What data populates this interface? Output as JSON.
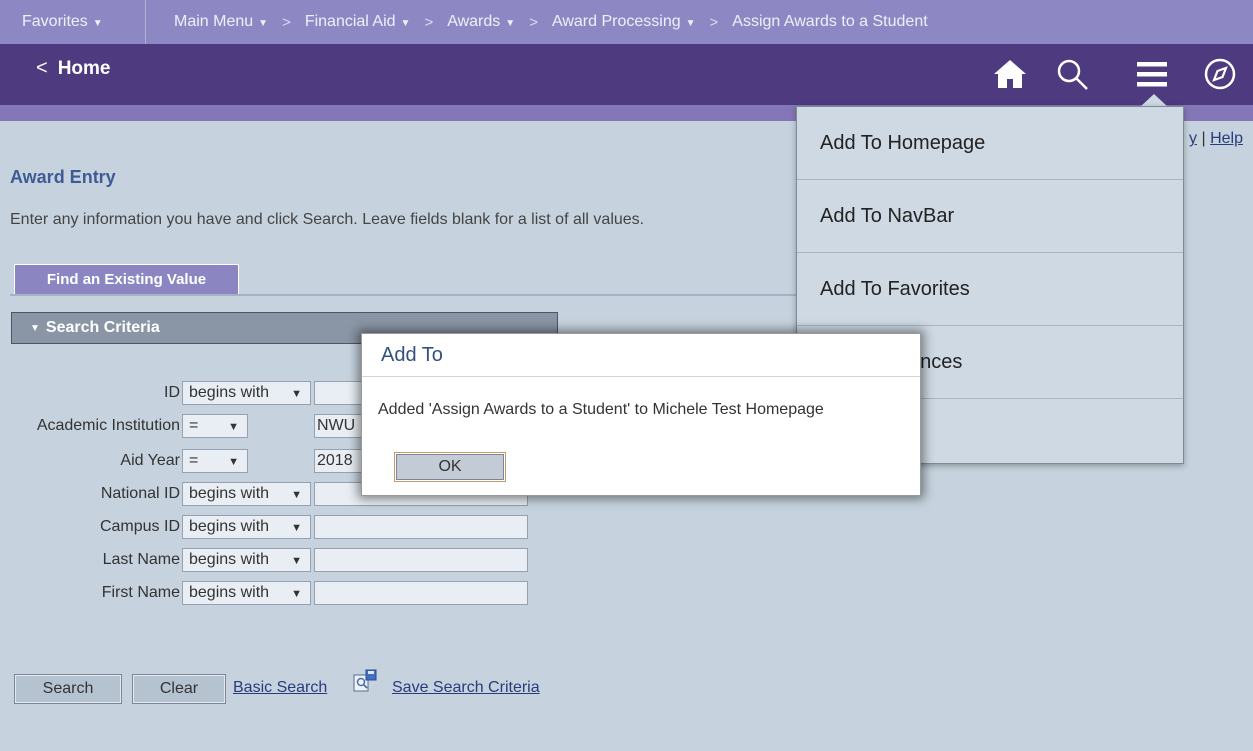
{
  "breadcrumb": {
    "favorites": "Favorites",
    "main_menu": "Main Menu",
    "items": [
      "Financial Aid",
      "Awards",
      "Award Processing"
    ],
    "current": "Assign Awards to a Student"
  },
  "header": {
    "back_label": "Home",
    "icons": [
      "home-icon",
      "search-icon",
      "menu-icon",
      "navbar-compass-icon"
    ]
  },
  "toplinks": {
    "partial": "y",
    "help": "Help"
  },
  "page": {
    "title": "Award Entry",
    "instructions": "Enter any information you have and click Search. Leave fields blank for a list of all values.",
    "tab_label": "Find an Existing Value",
    "criteria_label": "Search Criteria"
  },
  "fields": [
    {
      "label": "ID",
      "operator": "begins with",
      "value": ""
    },
    {
      "label": "Academic Institution",
      "operator": "=",
      "value": "NWU"
    },
    {
      "label": "Aid Year",
      "operator": "=",
      "value": "2018"
    },
    {
      "label": "National ID",
      "operator": "begins with",
      "value": ""
    },
    {
      "label": "Campus ID",
      "operator": "begins with",
      "value": ""
    },
    {
      "label": "Last Name",
      "operator": "begins with",
      "value": ""
    },
    {
      "label": "First Name",
      "operator": "begins with",
      "value": ""
    }
  ],
  "actions": {
    "search": "Search",
    "clear": "Clear",
    "basic_search": "Basic Search",
    "save_criteria": "Save Search Criteria"
  },
  "action_menu": {
    "items": [
      "Add To Homepage",
      "Add To NavBar",
      "Add To Favorites",
      "ences",
      ""
    ]
  },
  "dialog": {
    "title": "Add To",
    "message": "Added 'Assign Awards to a Student' to Michele Test Homepage",
    "ok": "OK"
  },
  "colors": {
    "header": "#4e3a7e",
    "breadcrumb_bar": "#8d88c4",
    "page_bg": "#c6d3de",
    "title": "#3e5b95"
  }
}
